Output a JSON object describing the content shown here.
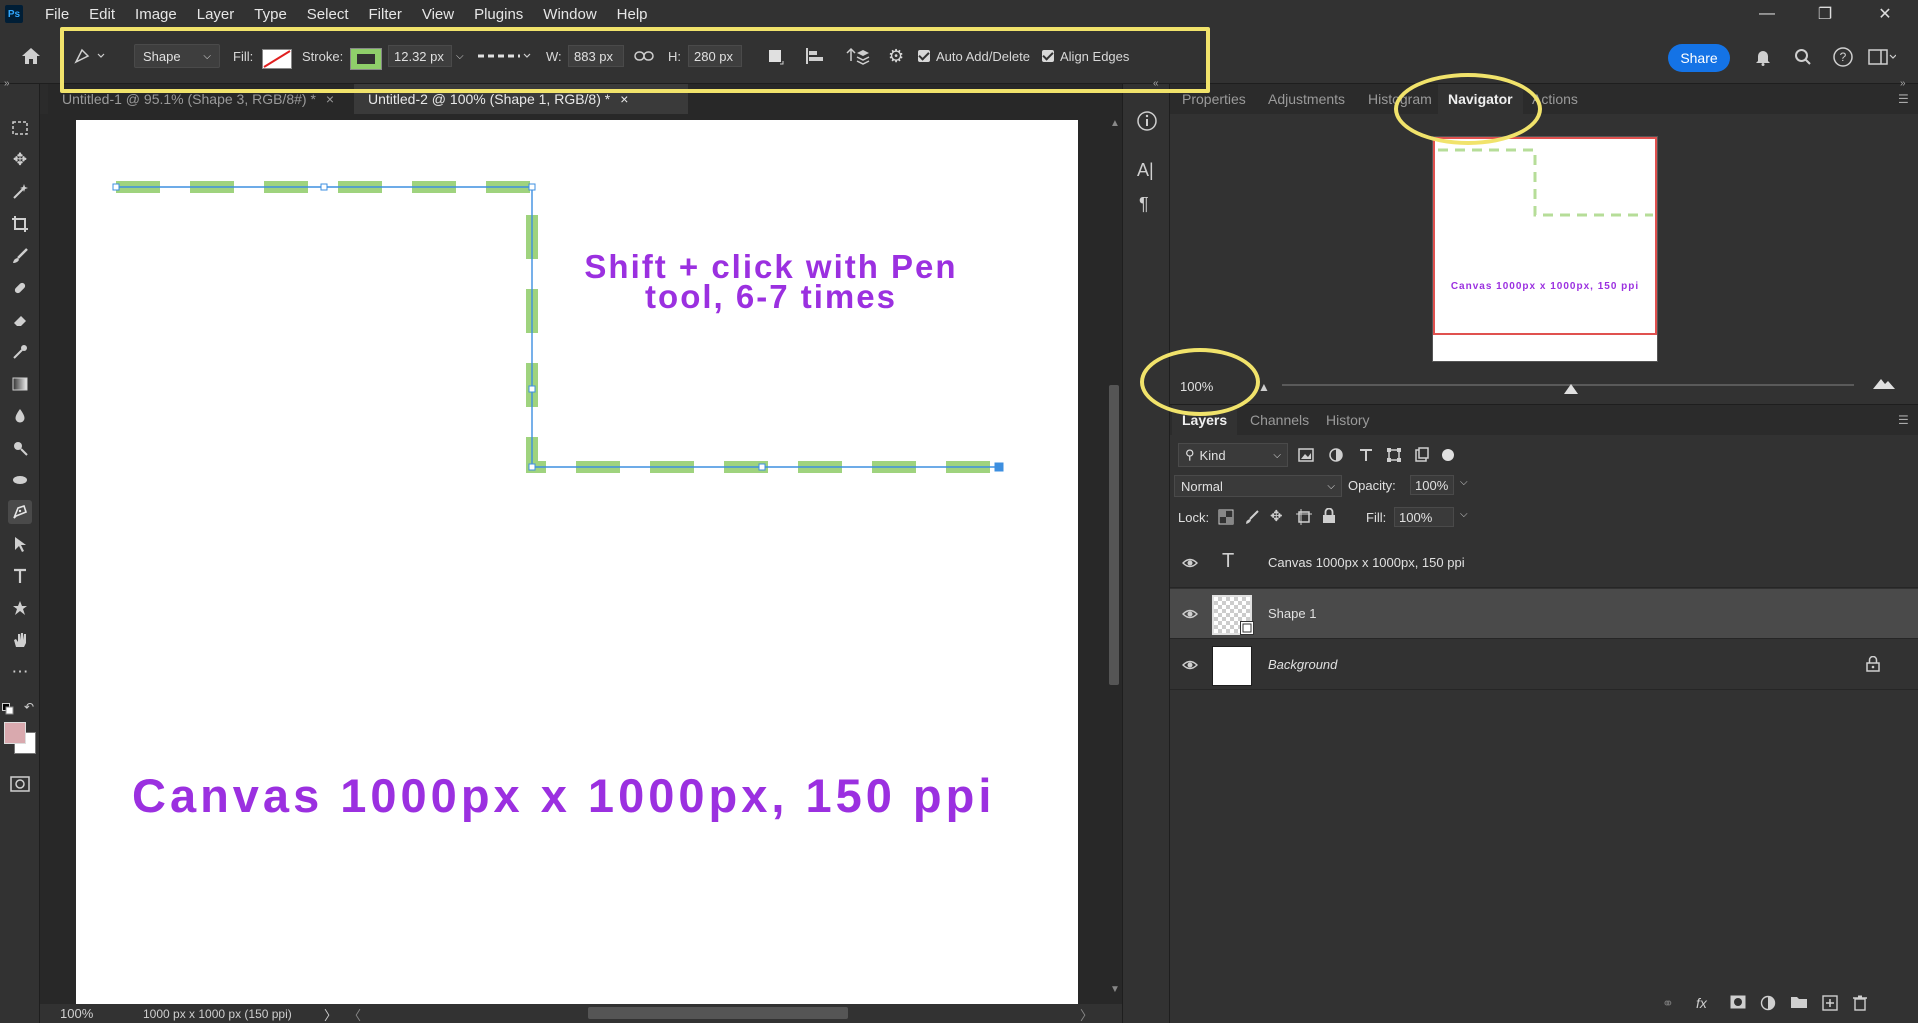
{
  "app": {
    "logo": "Ps",
    "menu": [
      "File",
      "Edit",
      "Image",
      "Layer",
      "Type",
      "Select",
      "Filter",
      "View",
      "Plugins",
      "Window",
      "Help"
    ],
    "window_controls": [
      "minimize-icon",
      "restore-icon",
      "close-icon"
    ]
  },
  "options_bar": {
    "mode": "Shape",
    "fill_label": "Fill:",
    "stroke_label": "Stroke:",
    "stroke_width": "12.32 px",
    "w_label": "W:",
    "w_value": "883 px",
    "h_label": "H:",
    "h_value": "280 px",
    "auto_add_delete": "Auto Add/Delete",
    "align_edges": "Align Edges",
    "share": "Share"
  },
  "doc_tabs": [
    {
      "label": "Untitled-1 @ 95.1% (Shape 3, RGB/8#) *",
      "close": "×"
    },
    {
      "label": "Untitled-2 @ 100% (Shape 1, RGB/8) *",
      "close": "×"
    }
  ],
  "canvas": {
    "instruction": "Shift + click with Pen tool, 6-7 times",
    "caption": "Canvas 1000px x 1000px, 150 ppi",
    "stroke_color": "#9fd37e",
    "text_color": "#9b30e0"
  },
  "status": {
    "zoom": "100%",
    "doc_info": "1000 px x 1000 px (150 ppi)"
  },
  "panels": {
    "top_tabs": [
      "Properties",
      "Adjustments",
      "Histogram",
      "Navigator",
      "Actions"
    ],
    "navigator": {
      "zoom": "100%",
      "preview_caption": "Canvas 1000px x 1000px, 150 ppi"
    },
    "layer_tabs": [
      "Layers",
      "Channels",
      "History"
    ],
    "filter_kind": "Kind",
    "blend_mode": "Normal",
    "opacity_label": "Opacity:",
    "opacity": "100%",
    "lock_label": "Lock:",
    "fill_label": "Fill:",
    "fill": "100%",
    "layers": [
      {
        "name": "Canvas 1000px x 1000px, 150 ppi",
        "kind": "text"
      },
      {
        "name": "Shape 1",
        "kind": "shape"
      },
      {
        "name": "Background",
        "kind": "background"
      }
    ]
  }
}
